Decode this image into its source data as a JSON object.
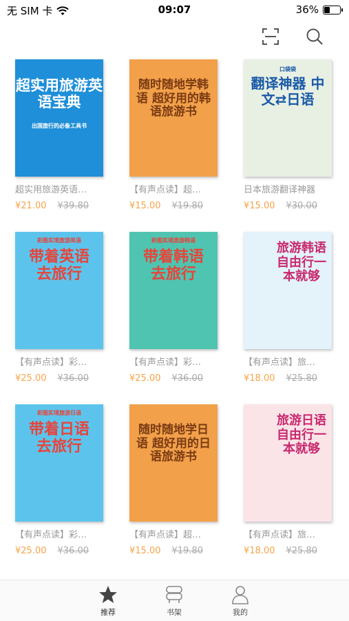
{
  "status": {
    "carrier": "无 SIM 卡",
    "time": "09:07",
    "battery": "36%",
    "battery_level": 0.36
  },
  "nav": {
    "scan_icon": "scan-icon",
    "search_icon": "search-icon"
  },
  "books": [
    {
      "cover_title": "超实用旅游英语宝典",
      "cover_subtitle": "出国旅行的必备工具书",
      "title": "超实用旅游英语…",
      "price": "¥21.00",
      "original": "¥39.80",
      "cover_color": "#1e8fd8",
      "title_color": "#ffffff"
    },
    {
      "cover_title": "随时随地学韩语 超好用的韩语旅游书",
      "cover_subtitle": "",
      "title": "【有声点读】超…",
      "price": "¥15.00",
      "original": "¥19.80",
      "cover_color": "#f2a04a",
      "title_color": "#7a3b12"
    },
    {
      "cover_title": "翻译神器 中文⇄日语",
      "cover_subtitle": "口袋袋",
      "title": "日本旅游翻译神器",
      "price": "¥15.00",
      "original": "¥30.00",
      "cover_color": "#e8f0e4",
      "title_color": "#1a5aa8"
    },
    {
      "cover_title": "带着英语去旅行",
      "cover_subtitle": "彩图实境旅游英语",
      "title": "【有声点读】彩…",
      "price": "¥25.00",
      "original": "¥36.00",
      "cover_color": "#5cc4ec",
      "title_color": "#e8443a"
    },
    {
      "cover_title": "带着韩语去旅行",
      "cover_subtitle": "彩图实境旅游韩语",
      "title": "【有声点读】彩…",
      "price": "¥25.00",
      "original": "¥36.00",
      "cover_color": "#4fc4b0",
      "title_color": "#e8443a"
    },
    {
      "cover_title": "旅游韩语 自由行一本就够",
      "cover_subtitle": "",
      "title": "【有声点读】旅…",
      "price": "¥18.00",
      "original": "¥25.80",
      "cover_color": "#e4f2fa",
      "title_color": "#c8286e"
    },
    {
      "cover_title": "带着日语去旅行",
      "cover_subtitle": "彩图实境旅游日语",
      "title": "【有声点读】彩…",
      "price": "¥25.00",
      "original": "¥36.00",
      "cover_color": "#5cc4ec",
      "title_color": "#e8443a"
    },
    {
      "cover_title": "随时随地学日语 超好用的日语旅游书",
      "cover_subtitle": "",
      "title": "【有声点读】超…",
      "price": "¥15.00",
      "original": "¥19.80",
      "cover_color": "#f2a04a",
      "title_color": "#7a3b12"
    },
    {
      "cover_title": "旅游日语 自由行一本就够",
      "cover_subtitle": "",
      "title": "【有声点读】旅…",
      "price": "¥18.00",
      "original": "¥25.80",
      "cover_color": "#fbe4e8",
      "title_color": "#c8286e"
    }
  ],
  "tabs": [
    {
      "label": "推荐",
      "icon": "star-icon",
      "active": true
    },
    {
      "label": "书架",
      "icon": "bookshelf-icon",
      "active": false
    },
    {
      "label": "我的",
      "icon": "user-icon",
      "active": false
    }
  ]
}
